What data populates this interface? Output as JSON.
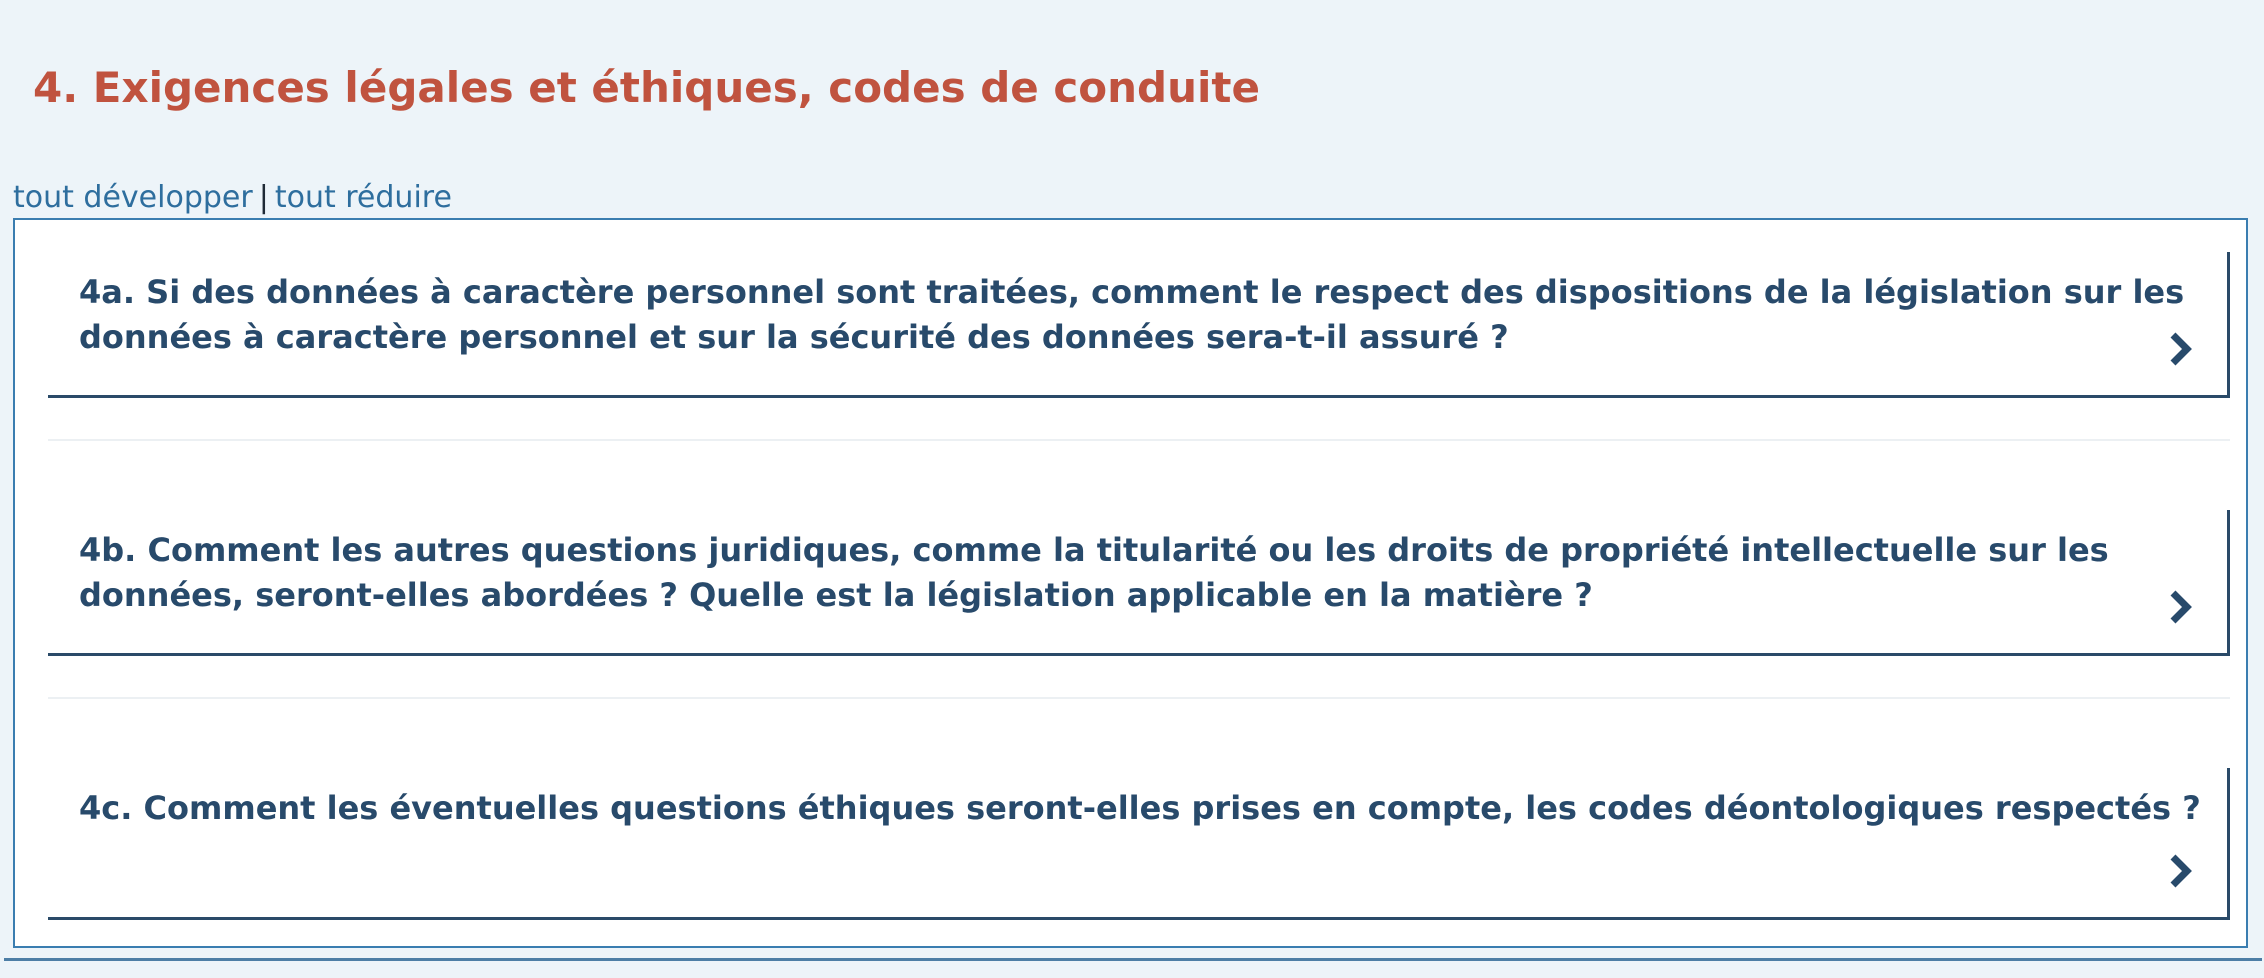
{
  "page": {
    "title": "4. Exigences légales et éthiques, codes de conduite"
  },
  "toolbar": {
    "expand_all": "tout développer",
    "separator": "|",
    "collapse_all": "tout réduire"
  },
  "questions": [
    {
      "text": "4a. Si des données à caractère personnel sont traitées, comment le respect des dispositions de la législation sur les données à caractère personnel et sur la sécurité des données sera-t-il assuré ?",
      "icon": "chevron-right-icon"
    },
    {
      "text": "4b. Comment les autres questions juridiques, comme la titularité ou les droits de propriété intellectuelle sur les données, seront-elles abordées ? Quelle est la législation applicable en la matière ?",
      "icon": "chevron-right-icon"
    },
    {
      "text": "4c. Comment les éventuelles questions éthiques seront-elles prises en compte, les codes déontologiques respectés ?",
      "icon": "chevron-right-icon"
    }
  ],
  "colors": {
    "title": "#c0533f",
    "question_text": "#284a6b",
    "link": "#2e6e9e",
    "page_background": "#edf4f9",
    "panel_border": "#3a7db0"
  }
}
